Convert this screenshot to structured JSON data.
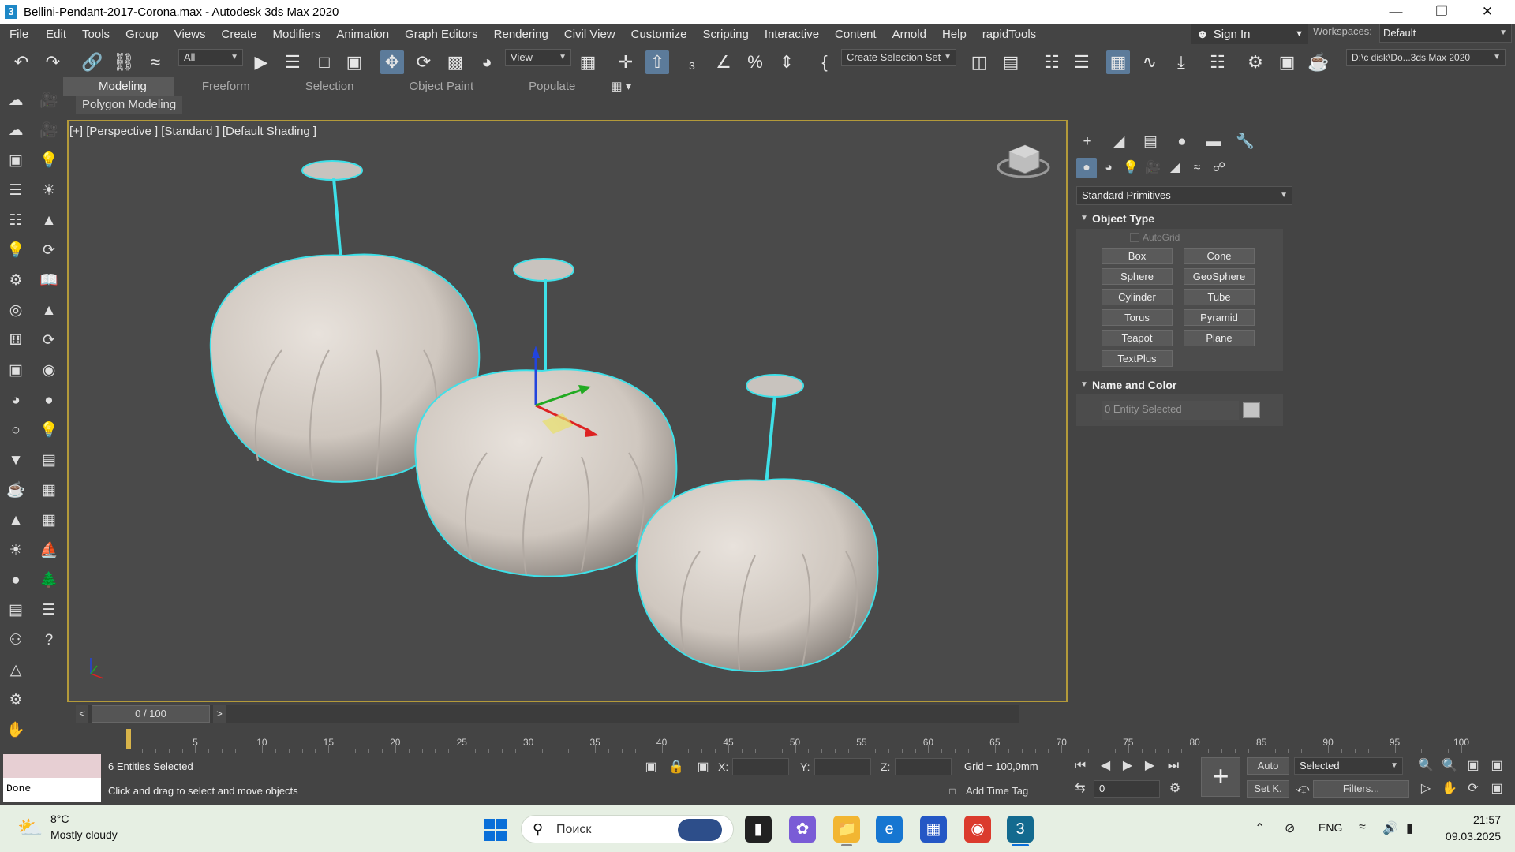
{
  "window": {
    "title": "Bellini-Pendant-2017-Corona.max - Autodesk 3ds Max 2020",
    "app_icon_glyph": "3",
    "controls": [
      "minimize-icon",
      "restore-icon",
      "close-icon"
    ]
  },
  "menubar": {
    "items": [
      "File",
      "Edit",
      "Tools",
      "Group",
      "Views",
      "Create",
      "Modifiers",
      "Animation",
      "Graph Editors",
      "Rendering",
      "Civil View",
      "Customize",
      "Scripting",
      "Interactive",
      "Content",
      "Arnold",
      "Help",
      "rapidTools"
    ],
    "sign_in": "Sign In",
    "workspaces_label": "Workspaces:",
    "workspace_value": "Default"
  },
  "toolbar": {
    "selection_filter": "All",
    "reference_coord": "View",
    "named_selection": "Create Selection Set",
    "project_path": "D:\\c disk\\Do...3ds Max 2020"
  },
  "ribbon": {
    "tabs": [
      "Modeling",
      "Freeform",
      "Selection",
      "Object Paint",
      "Populate"
    ],
    "active_tab": "Modeling",
    "subpanel": "Polygon Modeling"
  },
  "viewport": {
    "label": "[+] [Perspective ] [Standard ] [Default Shading ]",
    "selection_outline_color": "#3ee0e8",
    "object_color": "#d9d2cc"
  },
  "command_panel": {
    "category": "Standard Primitives",
    "object_type_title": "Object Type",
    "autogrid_label": "AutoGrid",
    "primitives": [
      "Box",
      "Cone",
      "Sphere",
      "GeoSphere",
      "Cylinder",
      "Tube",
      "Torus",
      "Pyramid",
      "Teapot",
      "Plane",
      "TextPlus"
    ],
    "name_color_title": "Name and Color",
    "name_field": "0 Entity Selected",
    "swatch_color": "#c4c4c4"
  },
  "timeline": {
    "slider_label": "0 / 100",
    "ticks": [
      5,
      10,
      15,
      20,
      25,
      30,
      35,
      40,
      45,
      50,
      55,
      60,
      65,
      70,
      75,
      80,
      85,
      90,
      95,
      100
    ],
    "first_tick": 0,
    "last_tick": 100
  },
  "status": {
    "maxscript_output": "Done",
    "selection_text": "6 Entities Selected",
    "prompt_text": "Click and drag to select and move objects",
    "x_label": "X:",
    "y_label": "Y:",
    "z_label": "Z:",
    "grid_text": "Grid = 100,0mm",
    "add_time_tag": "Add Time Tag",
    "auto_key": "Auto",
    "set_key": "Set K.",
    "key_filter_select": "Selected",
    "filters": "Filters...",
    "current_frame": "0"
  },
  "taskbar": {
    "weather_temp": "8°C",
    "weather_desc": "Mostly cloudy",
    "search_placeholder": "Поиск",
    "language": "ENG",
    "time": "21:57",
    "date": "09.03.2025"
  }
}
